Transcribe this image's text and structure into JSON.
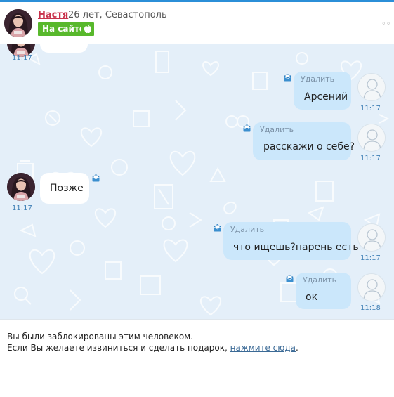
{
  "header": {
    "name": "Настя",
    "info": "26 лет, Севастополь",
    "online_label": "На сайте",
    "more_dots": "◦◦"
  },
  "messages": [
    {
      "side": "in",
      "text": "",
      "time": "11:17"
    },
    {
      "side": "out",
      "delete_label": "Удалить",
      "text": "Арсений",
      "time": "11:17"
    },
    {
      "side": "out",
      "delete_label": "Удалить",
      "text": "расскажи о себе?",
      "time": "11:17"
    },
    {
      "side": "in",
      "text": "Позже",
      "time": "11:17"
    },
    {
      "side": "out",
      "delete_label": "Удалить",
      "text": "что ищешь?парень есть",
      "time": "11:17"
    },
    {
      "side": "out",
      "delete_label": "Удалить",
      "text": "ок",
      "time": "11:18"
    }
  ],
  "footer": {
    "blocked_line": "Вы были заблокированы этим человеком.",
    "apology_prefix": "Если Вы желаете извиниться и сделать подарок, ",
    "apology_link": "нажмите сюда",
    "apology_suffix": "."
  },
  "colors": {
    "accent": "#2b8fd8",
    "name": "#c8324b",
    "online": "#58b82c",
    "chat_bg": "#e4eff9",
    "outgoing_bubble": "#cbe7fb",
    "incoming_bubble": "#ffffff",
    "time": "#3f7fb5"
  },
  "icons": [
    "apple-icon",
    "mail-icon",
    "default-avatar-icon"
  ]
}
